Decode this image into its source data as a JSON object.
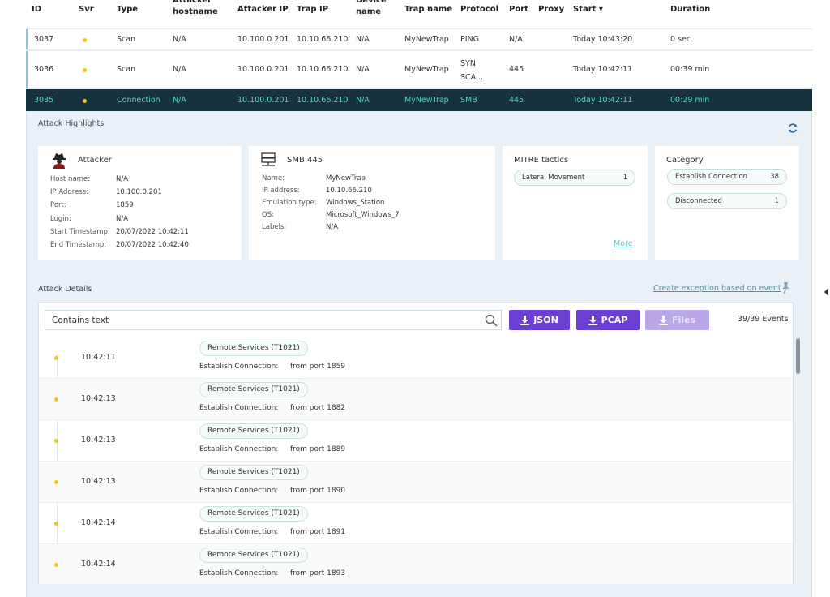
{
  "table": {
    "headers": {
      "id": "ID",
      "svr": "Svr",
      "type": "Type",
      "attacker_hostname": "Attacker hostname",
      "attacker_ip": "Attacker IP",
      "trap_ip": "Trap IP",
      "device_name": "Device name",
      "trap_name": "Trap name",
      "protocol": "Protocol",
      "port": "Port",
      "proxy": "Proxy",
      "start": "Start ▾",
      "duration": "Duration"
    },
    "rows": [
      {
        "id": "3037",
        "type": "Scan",
        "hostname": "N/A",
        "attacker_ip": "10.100.0.201",
        "trap_ip": "10.10.66.210",
        "device": "N/A",
        "trap_name": "MyNewTrap",
        "protocol": "PING",
        "port": "N/A",
        "proxy": "",
        "start": "Today 10:43:20",
        "duration": "0 sec"
      },
      {
        "id": "3036",
        "type": "Scan",
        "hostname": "N/A",
        "attacker_ip": "10.100.0.201",
        "trap_ip": "10.10.66.210",
        "device": "N/A",
        "trap_name": "MyNewTrap",
        "protocol": "SYN SCA...",
        "port": "445",
        "proxy": "",
        "start": "Today 10:42:11",
        "duration": "00:39 min"
      },
      {
        "id": "3035",
        "type": "Connection",
        "hostname": "N/A",
        "attacker_ip": "10.100.0.201",
        "trap_ip": "10.10.66.210",
        "device": "N/A",
        "trap_name": "MyNewTrap",
        "protocol": "SMB",
        "port": "445",
        "proxy": "",
        "start": "Today 10:42:11",
        "duration": "00:29 min"
      }
    ]
  },
  "highlights": {
    "title": "Attack Highlights",
    "attacker": {
      "title": "Attacker",
      "labels": [
        "Host name:",
        "IP Address:",
        "Port:",
        "Login:",
        "Start Timestamp:",
        "End Timestamp:"
      ],
      "values": [
        "N/A",
        "10.100.0.201",
        "1859",
        "N/A",
        "20/07/2022 10:42:11",
        "20/07/2022 10:42:40"
      ]
    },
    "smb": {
      "title": "SMB 445",
      "labels": [
        "Name:",
        "IP address:",
        "Emulation type:",
        "OS:",
        "Labels:"
      ],
      "values": [
        "MyNewTrap",
        "10.10.66.210",
        "Windows_Station",
        "Microsoft_Windows_7",
        "N/A"
      ]
    },
    "mitre": {
      "title": "MITRE tactics",
      "items": [
        {
          "label": "Lateral Movement",
          "count": "1"
        }
      ],
      "more": "More"
    },
    "category": {
      "title": "Category",
      "items": [
        {
          "label": "Establish Connection",
          "count": "38"
        },
        {
          "label": "Disconnected",
          "count": "1"
        }
      ]
    }
  },
  "details": {
    "title": "Attack Details",
    "exception_link": "Create exception based on event",
    "search": {
      "value": "Contains text"
    },
    "buttons": {
      "json": "JSON",
      "pcap": "PCAP",
      "files": "Files"
    },
    "event_count": "39/39 Events",
    "events": [
      {
        "time": "10:42:11",
        "tag": "Remote Services (T1021)",
        "label": "Establish Connection:",
        "detail": "from port 1859"
      },
      {
        "time": "10:42:13",
        "tag": "Remote Services (T1021)",
        "label": "Establish Connection:",
        "detail": "from port 1882"
      },
      {
        "time": "10:42:13",
        "tag": "Remote Services (T1021)",
        "label": "Establish Connection:",
        "detail": "from port 1889"
      },
      {
        "time": "10:42:13",
        "tag": "Remote Services (T1021)",
        "label": "Establish Connection:",
        "detail": "from port 1890"
      },
      {
        "time": "10:42:14",
        "tag": "Remote Services (T1021)",
        "label": "Establish Connection:",
        "detail": "from port 1891"
      },
      {
        "time": "10:42:14",
        "tag": "Remote Services (T1021)",
        "label": "Establish Connection:",
        "detail": "from port 1893"
      }
    ]
  },
  "colors": {
    "accent": "#6b3fd1",
    "selected_row": "#16323f",
    "selected_text": "#4fd6cc",
    "severity": "#f5c518"
  },
  "icons": {
    "refresh": "refresh-icon",
    "search": "search-icon",
    "download": "download-icon",
    "attacker": "spy-icon",
    "server": "server-icon",
    "exception": "pin-icon"
  }
}
